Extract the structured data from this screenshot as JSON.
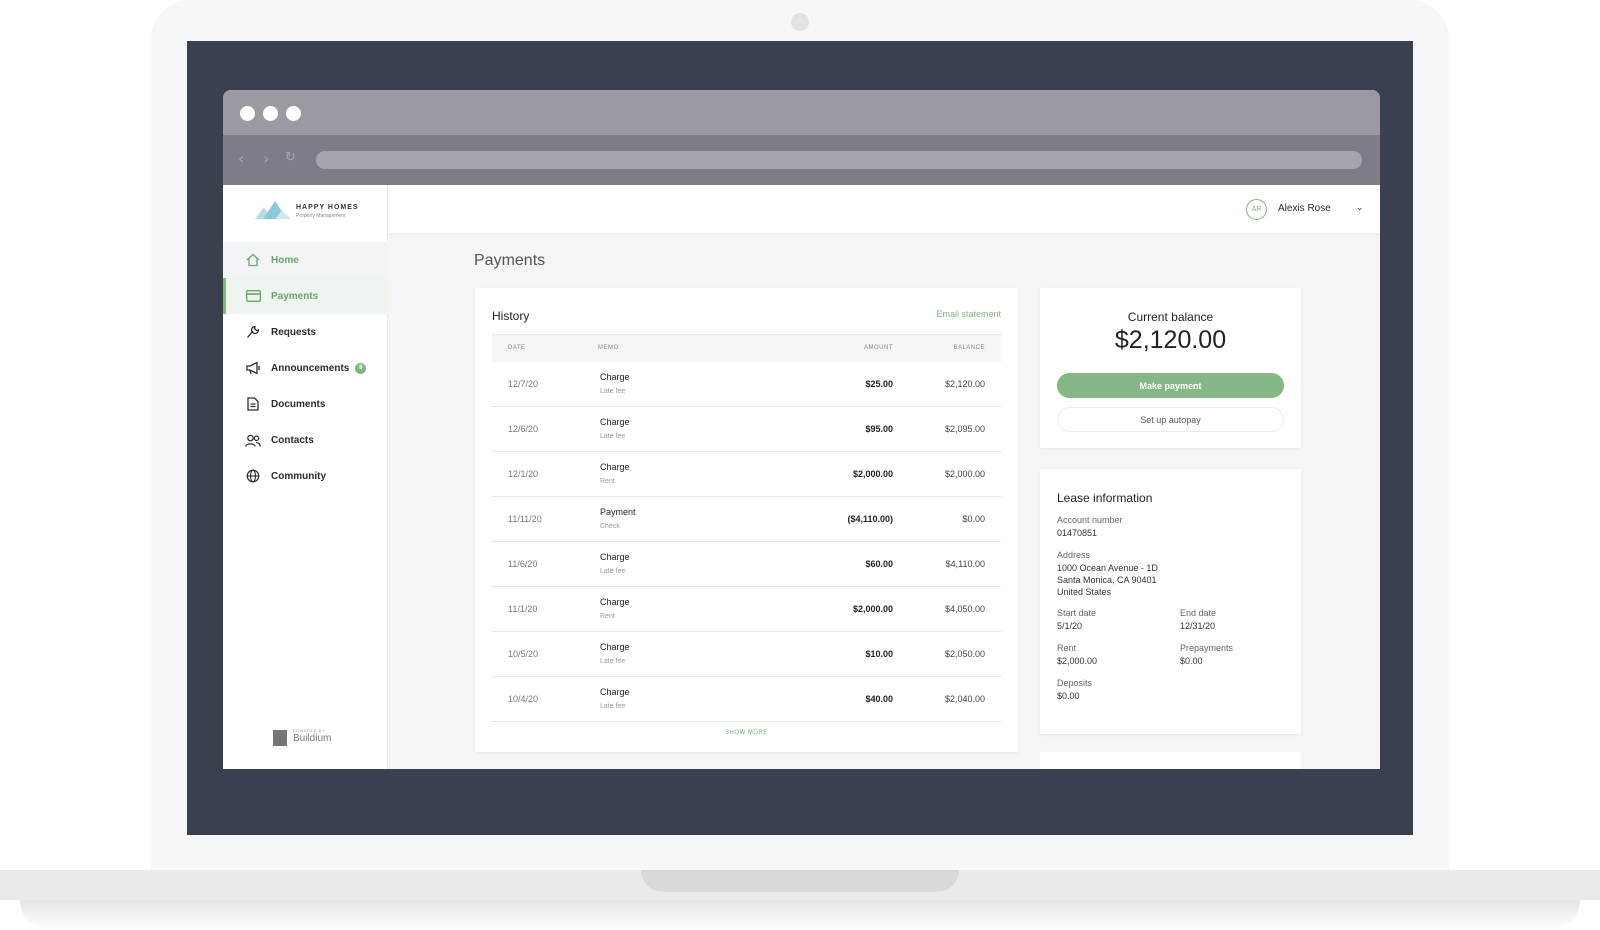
{
  "brand": {
    "name": "HAPPY HOMES",
    "tagline": "Property Management",
    "accent": "#7fb783",
    "powered_by_label": "POWERED BY",
    "powered_by_name": "Buildium"
  },
  "user": {
    "initials": "AR",
    "name": "Alexis Rose"
  },
  "sidebar": {
    "items": [
      {
        "label": "Home",
        "icon": "home-icon"
      },
      {
        "label": "Payments",
        "icon": "credit-card-icon"
      },
      {
        "label": "Requests",
        "icon": "wrench-icon"
      },
      {
        "label": "Announcements",
        "icon": "megaphone-icon",
        "badge": "8"
      },
      {
        "label": "Documents",
        "icon": "document-icon"
      },
      {
        "label": "Contacts",
        "icon": "people-icon"
      },
      {
        "label": "Community",
        "icon": "globe-icon"
      }
    ]
  },
  "page": {
    "title": "Payments"
  },
  "history": {
    "title": "History",
    "email_link": "Email statement",
    "columns": {
      "date": "DATE",
      "memo": "MEMO",
      "amount": "AMOUNT",
      "balance": "BALANCE"
    },
    "rows": [
      {
        "date": "12/7/20",
        "memo": "Charge",
        "sub": "Late fee",
        "amount": "$25.00",
        "balance": "$2,120.00"
      },
      {
        "date": "12/6/20",
        "memo": "Charge",
        "sub": "Late fee",
        "amount": "$95.00",
        "balance": "$2,095.00"
      },
      {
        "date": "12/1/20",
        "memo": "Charge",
        "sub": "Rent",
        "amount": "$2,000.00",
        "balance": "$2,000.00"
      },
      {
        "date": "11/11/20",
        "memo": "Payment",
        "sub": "Check",
        "amount": "($4,110.00)",
        "balance": "$0.00"
      },
      {
        "date": "11/6/20",
        "memo": "Charge",
        "sub": "Late fee",
        "amount": "$60.00",
        "balance": "$4,110.00"
      },
      {
        "date": "11/1/20",
        "memo": "Charge",
        "sub": "Rent",
        "amount": "$2,000.00",
        "balance": "$4,050.00"
      },
      {
        "date": "10/5/20",
        "memo": "Charge",
        "sub": "Late fee",
        "amount": "$10.00",
        "balance": "$2,050.00"
      },
      {
        "date": "10/4/20",
        "memo": "Charge",
        "sub": "Late fee",
        "amount": "$40.00",
        "balance": "$2,040.00"
      }
    ],
    "show_more": "SHOW MORE"
  },
  "balance": {
    "label": "Current balance",
    "value": "$2,120.00",
    "pay_label": "Make payment",
    "autopay_label": "Set up autopay"
  },
  "lease": {
    "title": "Lease information",
    "account_label": "Account number",
    "account_value": "01470851",
    "address_label": "Address",
    "address_line1": "1000 Ocean Avenue - 1D",
    "address_line2": "Santa Monica, CA 90401",
    "address_line3": "United States",
    "start_label": "Start date",
    "start_value": "5/1/20",
    "end_label": "End date",
    "end_value": "12/31/20",
    "rent_label": "Rent",
    "rent_value": "$2,000.00",
    "prepay_label": "Prepayments",
    "prepay_value": "$0.00",
    "deposits_label": "Deposits",
    "deposits_value": "$0.00"
  }
}
